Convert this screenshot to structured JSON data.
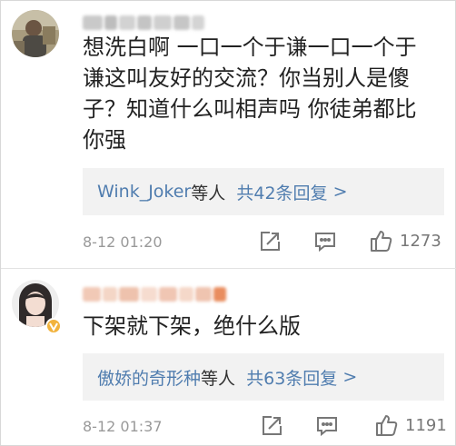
{
  "comments": [
    {
      "text": "想洗白啊  一口一个于谦一口一个于谦这叫友好的交流？你当别人是傻子？知道什么叫相声吗  你徒弟都比你强",
      "reply": {
        "users": "Wink_Joker",
        "users_suffix": "等人",
        "total": "共42条回复",
        "arrow": ">"
      },
      "time": "8-12 01:20",
      "likes": "1273",
      "icons": [
        "share-icon",
        "comment-icon",
        "like-icon"
      ]
    },
    {
      "text": "下架就下架，绝什么版",
      "reply": {
        "users": "傲娇的奇形种",
        "users_suffix": "等人",
        "total": "共63条回复",
        "arrow": ">"
      },
      "time": "8-12 01:37",
      "likes": "1191",
      "icons": [
        "share-icon",
        "comment-icon",
        "like-icon"
      ]
    }
  ],
  "colors": {
    "link": "#507daf",
    "reply_bg": "#f2f2f2",
    "meta": "#999999",
    "badge": "#f2b33d"
  }
}
